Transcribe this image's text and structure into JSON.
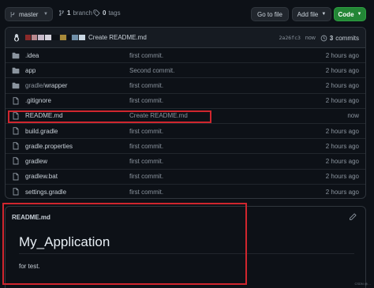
{
  "toolbar": {
    "branch": "master",
    "branches_count": "1",
    "branches_label": "branch",
    "tags_count": "0",
    "tags_label": "tags",
    "goto_file": "Go to file",
    "add_file": "Add file",
    "code": "Code"
  },
  "commit": {
    "message": "Create README.md",
    "sha": "2a26fc3",
    "time": "now",
    "commits_count": "3",
    "commits_label": "commits"
  },
  "files": [
    {
      "type": "folder",
      "name": ".idea",
      "commit": "first commit.",
      "age": "2 hours ago"
    },
    {
      "type": "folder",
      "name": "app",
      "commit": "Second commit.",
      "age": "2 hours ago"
    },
    {
      "type": "folder",
      "name_dim": "gradle/",
      "name": "wrapper",
      "commit": "first commit.",
      "age": "2 hours ago"
    },
    {
      "type": "file",
      "name": ".gitignore",
      "commit": "first commit.",
      "age": "2 hours ago"
    },
    {
      "type": "file",
      "name": "README.md",
      "commit": "Create README.md",
      "age": "now"
    },
    {
      "type": "file",
      "name": "build.gradle",
      "commit": "first commit.",
      "age": "2 hours ago"
    },
    {
      "type": "file",
      "name": "gradle.properties",
      "commit": "first commit.",
      "age": "2 hours ago"
    },
    {
      "type": "file",
      "name": "gradlew",
      "commit": "first commit.",
      "age": "2 hours ago"
    },
    {
      "type": "file",
      "name": "gradlew.bat",
      "commit": "first commit.",
      "age": "2 hours ago"
    },
    {
      "type": "file",
      "name": "settings.gradle",
      "commit": "first commit.",
      "age": "2 hours ago"
    }
  ],
  "readme": {
    "filename": "README.md",
    "title": "My_Application",
    "body": "for test."
  },
  "watermark": "CSDN @…",
  "colors": {
    "background": "#0d1117",
    "green_button": "#238636",
    "highlight": "#d0262e",
    "folder_icon": "#8b949e"
  },
  "icons": {
    "branch": "git-branch-icon",
    "tag": "tag-icon",
    "history": "history-icon",
    "folder": "folder-icon",
    "file": "file-icon",
    "edit": "pencil-icon"
  }
}
